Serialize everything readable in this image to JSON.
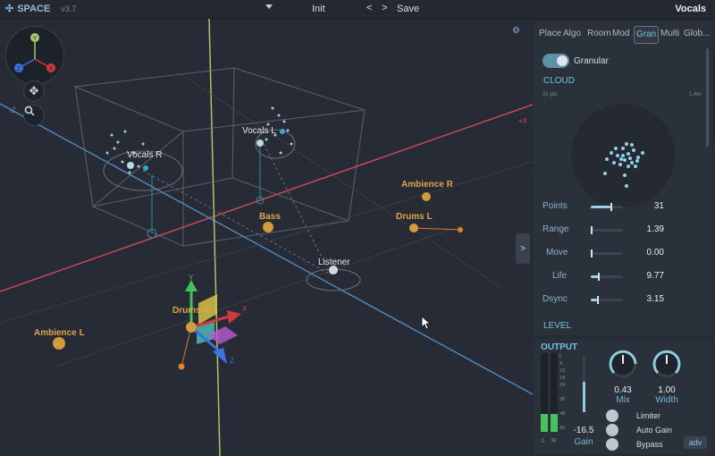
{
  "app": {
    "name": "SPACE",
    "version": "v3.7",
    "preset": "Init",
    "prev": "<",
    "next": ">",
    "save": "Save",
    "track": "Vocals"
  },
  "viewport": {
    "labels": {
      "vocals_r": "Vocals R",
      "vocals_l": "Vocals L",
      "ambience_r": "Ambience R",
      "drums_l": "Drums L",
      "bass": "Bass",
      "listener": "Listener",
      "drums_r": "Drums R",
      "ambience_l": "Ambience L"
    },
    "axes": {
      "x": "X",
      "y": "Y",
      "z": "Z",
      "plus_x": "+X",
      "minus_z": "-Z"
    },
    "expand": ">"
  },
  "panel": {
    "tabs": [
      "Place",
      "Algo",
      "Room",
      "Mod",
      "Gran",
      "Multi",
      "Glob..."
    ],
    "active_tab": "Gran",
    "granular_label": "Granular",
    "cloud_title": "CLOUD",
    "cloud_pts": "31 pts",
    "cloud_size": "1.4m",
    "level_title": "LEVEL",
    "params": [
      {
        "name": "Points",
        "value": "31",
        "fill": 0.6
      },
      {
        "name": "Range",
        "value": "1.39",
        "fill": 0.05
      },
      {
        "name": "Move",
        "value": "0.00",
        "fill": 0.0
      },
      {
        "name": "Life",
        "value": "9.77",
        "fill": 0.25
      },
      {
        "name": "Dsync",
        "value": "3.15",
        "fill": 0.2
      }
    ]
  },
  "output": {
    "title": "OUTPUT",
    "scale": [
      "0",
      "-6",
      "-12",
      "-18",
      "-24",
      "",
      "-36",
      "",
      "-48",
      "",
      "-60"
    ],
    "meter_l": "L",
    "meter_r": "R",
    "gain_value": "-16.5",
    "gain_label": "Gain",
    "mix_value": "0.43",
    "mix_label": "Mix",
    "width_value": "1.00",
    "width_label": "Width",
    "limiter": "Limiter",
    "auto_gain": "Auto Gain",
    "bypass": "Bypass",
    "adv": "adv"
  }
}
